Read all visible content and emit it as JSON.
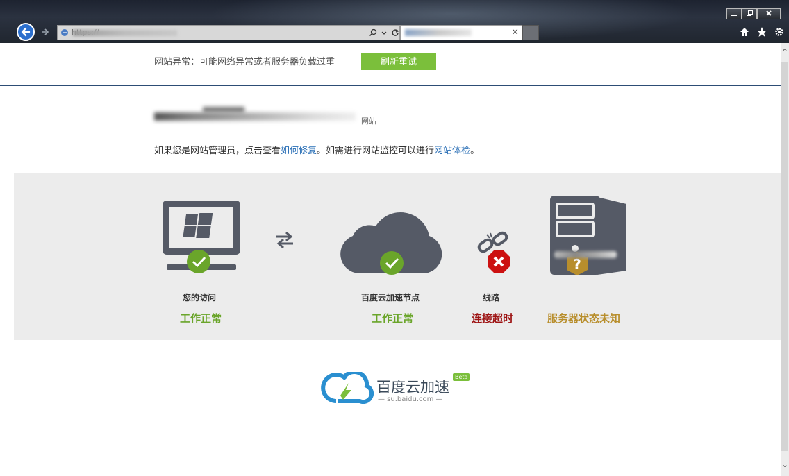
{
  "browser": {
    "url_display": "https://",
    "tab_close": "×",
    "window_controls": [
      "‒",
      "❐",
      "✕"
    ]
  },
  "page": {
    "error_message": "网站异常：可能网络异常或者服务器负载过重",
    "retry_label": "刷新重试",
    "site_suffix": "网站",
    "admin_prefix": "如果您是网站管理员，点击查看",
    "repair_link": "如何修复",
    "admin_middle": "。如需进行网站监控可以进行",
    "checkup_link": "网站体检",
    "admin_suffix": "。"
  },
  "status": {
    "visit": {
      "title": "您的访问",
      "state": "工作正常"
    },
    "node": {
      "title": "百度云加速节点",
      "state": "工作正常"
    },
    "route": {
      "title": "线路",
      "state": "连接超时"
    },
    "server": {
      "state": "服务器状态未知"
    }
  },
  "footer": {
    "brand_name": "百度云加速",
    "brand_domain": "— su.baidu.com —",
    "badge": "Beta"
  },
  "colors": {
    "ok": "#6aa52a",
    "error": "#9d1212",
    "unknown": "#b88e2c",
    "retry_button": "#7bbf3b",
    "icon_gray": "#555a66"
  },
  "icons": [
    "back-arrow-icon",
    "forward-arrow-icon",
    "search-icon",
    "refresh-icon",
    "home-icon",
    "favorites-star-icon",
    "settings-gear-icon",
    "computer-icon",
    "swap-arrows-icon",
    "cloud-icon",
    "broken-link-icon",
    "server-icon",
    "check-icon",
    "error-x-icon",
    "question-icon"
  ]
}
